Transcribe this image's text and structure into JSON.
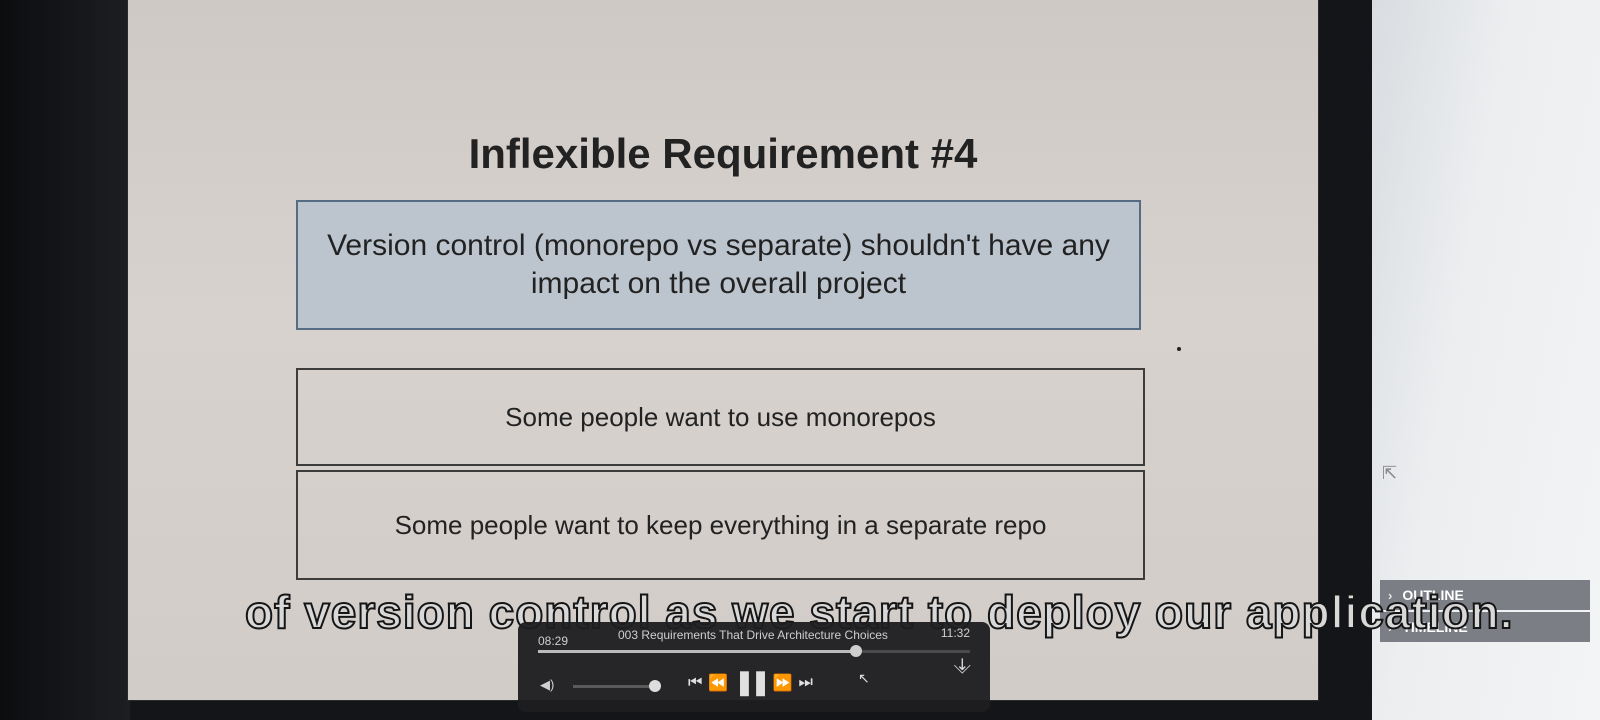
{
  "slide": {
    "title": "Inflexible Requirement #4",
    "main_box": "Version control (monorepo vs separate) shouldn't have any impact on the overall project",
    "box_1": "Some people want to use monorepos",
    "box_2": "Some people want to keep everything in a separate repo"
  },
  "subtitle": "of version control as we start to deploy our application.",
  "player": {
    "current_time": "08:29",
    "title": "003 Requirements That Drive Architecture Choices",
    "duration": "11:32",
    "progress": 0.735,
    "volume": 1.0
  },
  "sidebar": {
    "sections": [
      {
        "label": "OUTLINE"
      },
      {
        "label": "TIMELINE"
      }
    ]
  }
}
